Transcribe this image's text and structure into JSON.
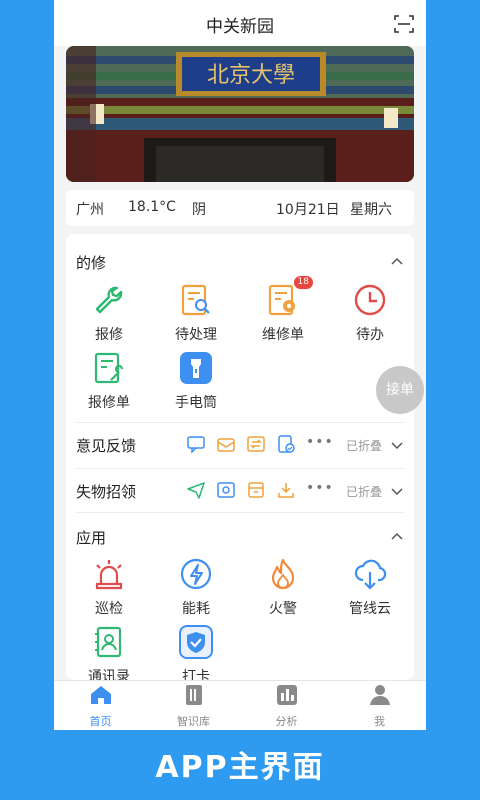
{
  "app": {
    "title": "中关新园"
  },
  "banner": {
    "plaque_text": "北京大學"
  },
  "weather": {
    "city": "广州",
    "temp": "18.1°C",
    "condition": "阴",
    "date": "10月21日",
    "weekday": "星期六"
  },
  "sections": {
    "dexiu": {
      "title": "的修",
      "items": [
        {
          "label": "报修",
          "icon": "wrench-icon",
          "color": "#2eb872"
        },
        {
          "label": "待处理",
          "icon": "doc-search-icon",
          "color": "#f0a03c"
        },
        {
          "label": "维修单",
          "icon": "doc-gear-icon",
          "color": "#f0a03c",
          "badge": "18"
        },
        {
          "label": "待办",
          "icon": "clock-icon",
          "color": "#e04b4b"
        },
        {
          "label": "报修单",
          "icon": "doc-wrench-icon",
          "color": "#2eb872"
        },
        {
          "label": "手电筒",
          "icon": "flashlight-icon",
          "color": "#3d8ff0"
        }
      ]
    },
    "feedback": {
      "title": "意见反馈",
      "folded": "已折叠",
      "dots": "•••"
    },
    "lost": {
      "title": "失物招领",
      "folded": "已折叠",
      "dots": "•••"
    },
    "apps": {
      "title": "应用",
      "items": [
        {
          "label": "巡检",
          "icon": "siren-icon",
          "color": "#e04b4b"
        },
        {
          "label": "能耗",
          "icon": "bolt-icon",
          "color": "#3d8ff0"
        },
        {
          "label": "火警",
          "icon": "fire-icon",
          "color": "#f08a3c"
        },
        {
          "label": "管线云",
          "icon": "cloud-download-icon",
          "color": "#3d8ff0"
        },
        {
          "label": "通讯录",
          "icon": "contacts-icon",
          "color": "#2eb872"
        },
        {
          "label": "打卡",
          "icon": "checkin-icon",
          "color": "#3d8ff0"
        }
      ]
    }
  },
  "float_button": {
    "label": "接单"
  },
  "tabbar": [
    {
      "label": "首页",
      "icon": "home-icon",
      "active": true
    },
    {
      "label": "智识库",
      "icon": "library-icon",
      "active": false
    },
    {
      "label": "分析",
      "icon": "chart-icon",
      "active": false
    },
    {
      "label": "我",
      "icon": "user-icon",
      "active": false
    }
  ],
  "caption": "APP主界面",
  "colors": {
    "background": "#2f9bf0",
    "accent": "#3d8ff0",
    "green": "#2eb872",
    "orange": "#f0a03c",
    "red": "#e04b4b"
  }
}
